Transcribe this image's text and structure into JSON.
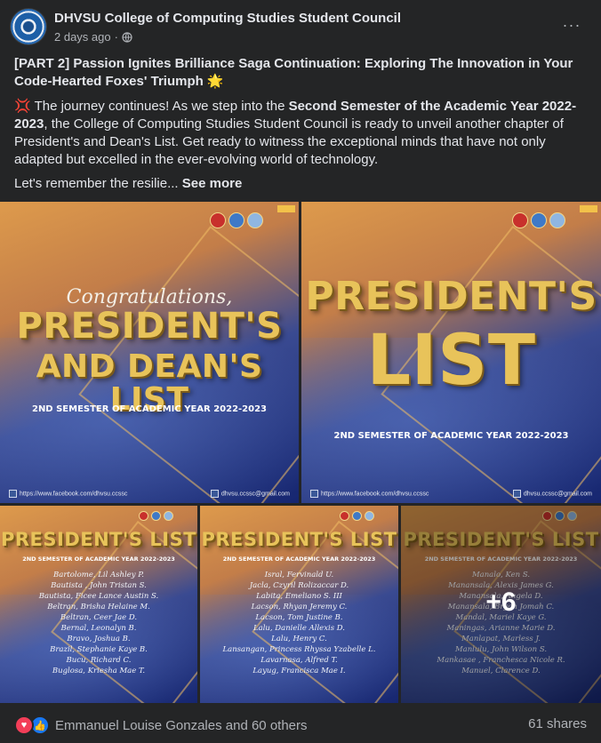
{
  "header": {
    "page_name": "DHVSU College of Computing Studies Student Council",
    "time_ago": "2 days ago",
    "separator": "·",
    "more_label": "···"
  },
  "post": {
    "title": "[PART 2] Passion Ignites Brilliance Saga Continuation: Exploring The Innovation in Your Code-Hearted Foxes' Triumph 🌟",
    "para1_prefix": "💢 The journey continues! As we step into the ",
    "para1_bold": "Second Semester of the Academic Year 2022-2023",
    "para1_suffix": ", the College of Computing Studies Student Council is ready to unveil another chapter of President's and Dean's List. Get ready to witness the exceptional minds that have not only adapted but excelled in the ever-evolving world of technology.",
    "para2": "Let's remember the resilie...",
    "see_more": "See more"
  },
  "images": {
    "poster1": {
      "congrats": "Congratulations,",
      "line1": "PRESIDENT'S",
      "line2": "AND DEAN'S LIST",
      "subtitle": "2ND SEMESTER OF ACADEMIC YEAR 2022-2023",
      "footer_fb": "https://www.facebook.com/dhvsu.ccssc",
      "footer_mail": "dhvsu.ccssc@gmail.com"
    },
    "poster2": {
      "line1": "PRESIDENT'S",
      "line2": "LIST",
      "subtitle": "2ND SEMESTER OF ACADEMIC YEAR 2022-2023",
      "footer_fb": "https://www.facebook.com/dhvsu.ccssc",
      "footer_mail": "dhvsu.ccssc@gmail.com"
    },
    "list_title": "PRESIDENT'S LIST",
    "list_subtitle": "2ND SEMESTER OF ACADEMIC YEAR 2022-2023",
    "list1": [
      "Bartolome, Lil Ashley P.",
      "Bautista , John Tristan S.",
      "Bautista, Ficee Lance Austin S.",
      "Beltran, Brisha Helaine M.",
      "Beltran, Ceer Jae D.",
      "Bernal, Leonalyn B.",
      "Bravo, Joshua B.",
      "Brazil, Stephanie Kaye B.",
      "Bucu, Richard C.",
      "Buglosa, Kriesha Mae T."
    ],
    "list2": [
      "Isral, Fervinald U.",
      "Jacla, Czyril Rolizaccar D.",
      "Labita, Emeliano S. III",
      "Lacson, Rhyan Jeremy C.",
      "Lacson, Tom Justine B.",
      "Lalu, Danielle Allexis D.",
      "Lalu, Henry C.",
      "Lansangan, Princess Rhyssa Yzabelle L.",
      "Lavarnasa, Alfred T.",
      "Layug, Francisca Mae I."
    ],
    "list3": [
      "Manalo, Ken S.",
      "Manansala, Alexis James G.",
      "Manansala, Angela D.",
      "Manansala, Bryan Jomah C.",
      "Mandal, Mariel Kaye G.",
      "Maningas, Arianne Marie D.",
      "Manlapat, Marless J.",
      "Manlulu, John Wilson S.",
      "Mankasae , Franchesca Nicole R.",
      "Manuel, Clarence D."
    ],
    "more_count": "+6"
  },
  "footer": {
    "reactions_text": "Emmanuel Louise Gonzales and 60 others",
    "shares": "61 shares"
  },
  "colors": {
    "background": "#242526",
    "text_primary": "#e4e6eb",
    "text_secondary": "#b0b3b8",
    "heart": "#f33e58",
    "like": "#1877f2",
    "poster_gold": "#e8c35a"
  }
}
